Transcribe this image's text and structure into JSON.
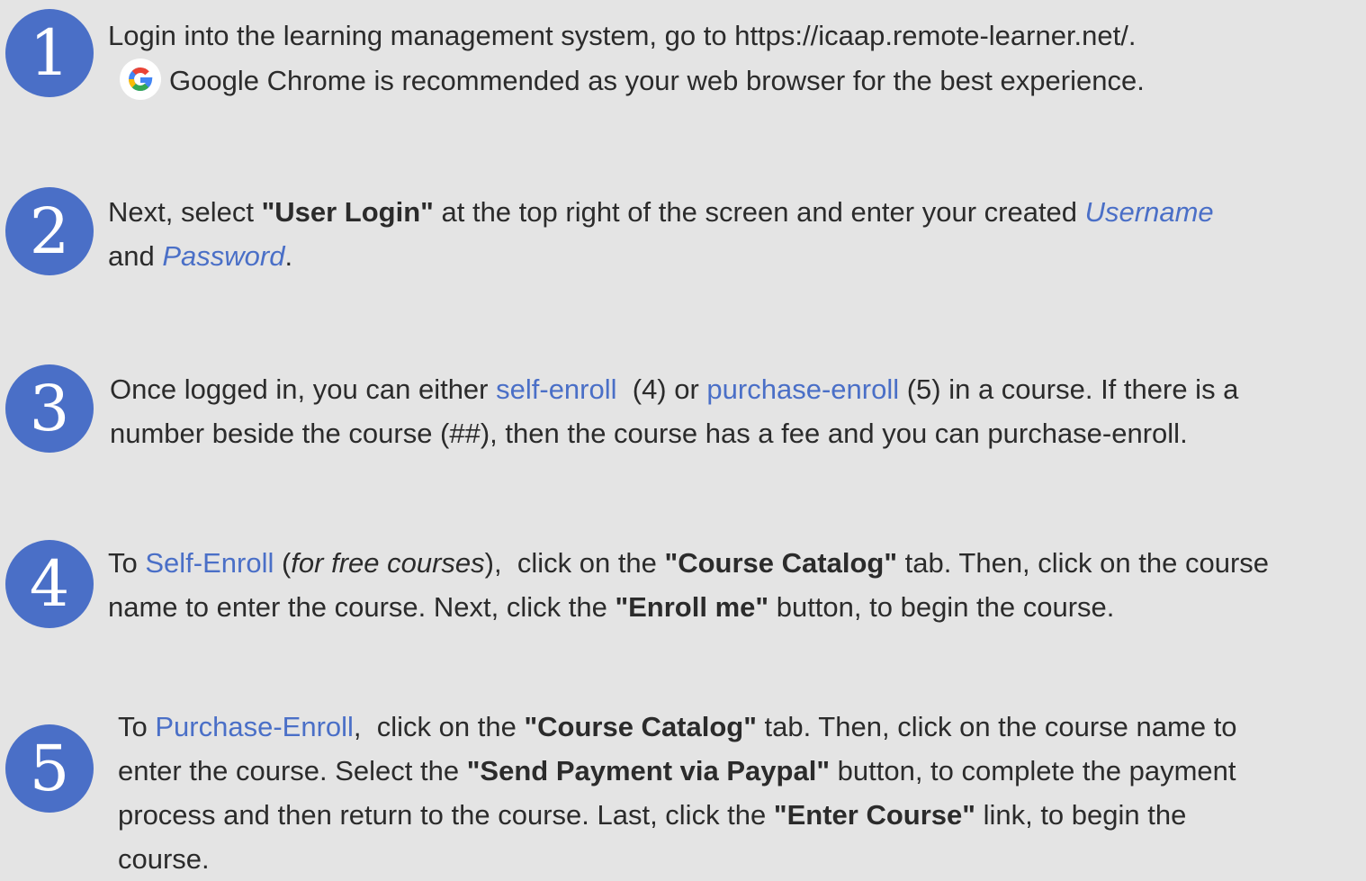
{
  "accent_color": "#4a6fc7",
  "background_color": "#e4e4e4",
  "steps": [
    {
      "number": "1",
      "line1": "Login into the learning management system, go to https://icaap.remote-learner.net/.",
      "line2": "Google Chrome is recommended as your web browser for the best experience.",
      "icon": "google-icon"
    },
    {
      "number": "2",
      "a": "Next, select ",
      "b_bold": "\"User Login\"",
      "c": " at the top right of the screen and enter your created ",
      "d_link": "Username",
      "e": "and ",
      "f_link": "Password",
      "g": "."
    },
    {
      "number": "3",
      "a": "Once logged in, you can either ",
      "b_link": "self-enroll",
      "c": "  (4) or ",
      "d_link": "purchase-enroll",
      "e": " (5) in a course. If there is a",
      "line2": "number beside the course (##), then the course has a fee and you can purchase-enroll."
    },
    {
      "number": "4",
      "a": "To ",
      "b_link": "Self-Enroll",
      "c": " (",
      "d_em": "for free courses",
      "e": "),  click on the ",
      "f_bold": "\"Course Catalog\"",
      "g": " tab. Then, click on the course",
      "h": "name to enter the course. Next, click the ",
      "i_bold": "\"Enroll me\"",
      "j": " button, to begin the course."
    },
    {
      "number": "5",
      "a": "To ",
      "b_link": "Purchase-Enroll",
      "c": ",  click on the ",
      "d_bold": "\"Course Catalog\"",
      "e": " tab. Then, click on the course name to",
      "f": "enter the course. Select the ",
      "g_bold": "\"Send Payment via Paypal\"",
      "h": " button, to complete the payment",
      "i": "process and then return to the course. Last, click the ",
      "j_bold": "\"Enter Course\"",
      "k": " link, to begin the",
      "l": "course."
    }
  ]
}
